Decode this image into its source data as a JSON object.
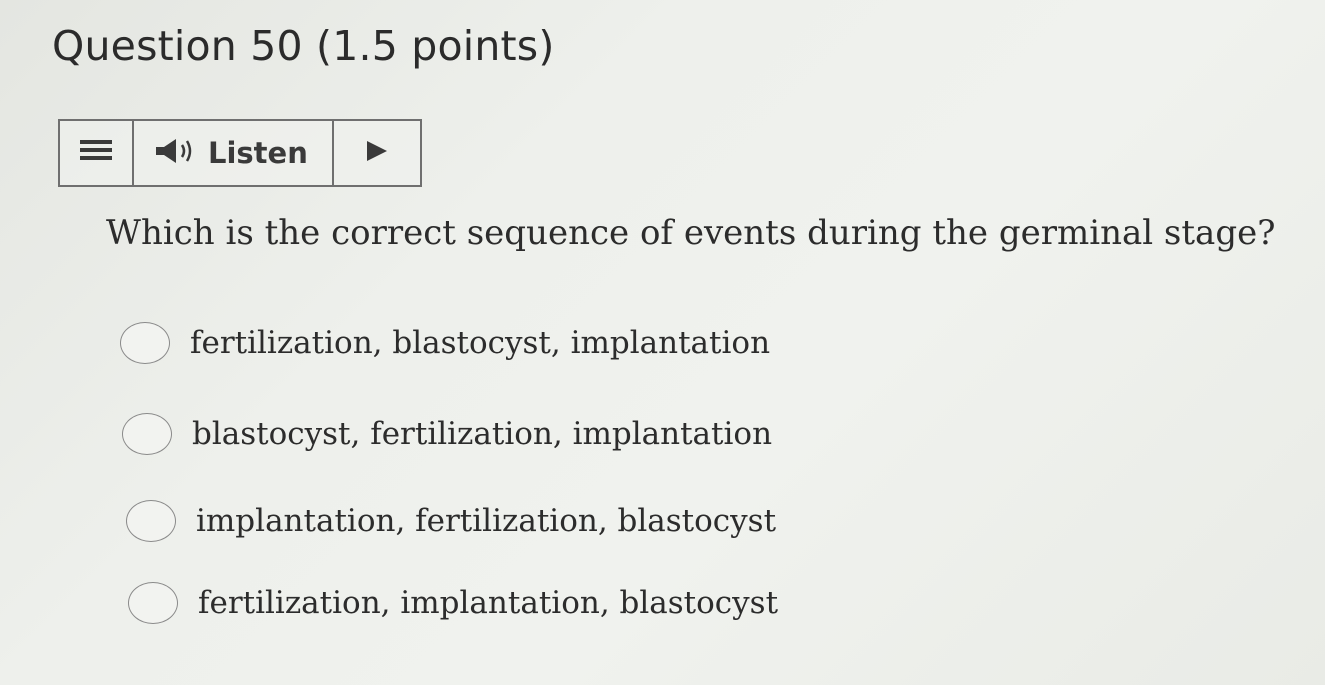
{
  "question": {
    "title": "Question 50 (1.5 points)",
    "prompt": "Which is the correct sequence of events during the germinal stage?"
  },
  "listen_bar": {
    "menu_icon": "menu-icon",
    "speaker_icon": "speaker-icon",
    "listen_label": "Listen",
    "play_icon": "play-icon"
  },
  "options": [
    {
      "label": "fertilization, blastocyst, implantation",
      "selected": false
    },
    {
      "label": "blastocyst, fertilization, implantation",
      "selected": false
    },
    {
      "label": "implantation, fertilization, blastocyst",
      "selected": false
    },
    {
      "label": "fertilization, implantation, blastocyst",
      "selected": false
    }
  ]
}
